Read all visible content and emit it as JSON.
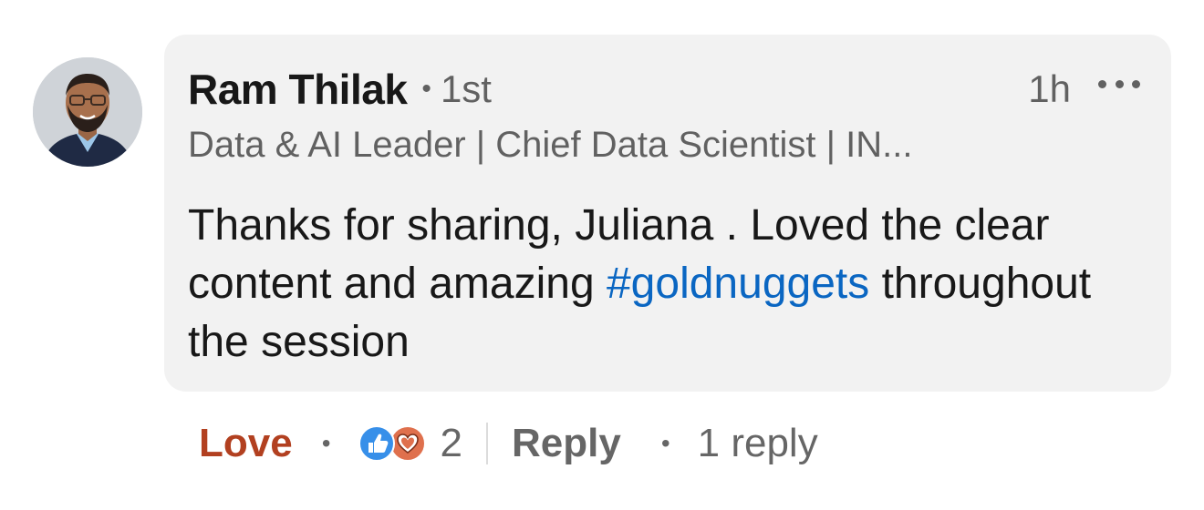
{
  "comment": {
    "author": {
      "name": "Ram Thilak",
      "separator": "•",
      "connection_degree": "1st",
      "headline": "Data & AI Leader | Chief Data Scientist | IN...",
      "avatar_icon": "profile-photo"
    },
    "timestamp": "1h",
    "more_icon": "more-horizontal-icon",
    "text": {
      "before_hashtag": "Thanks for sharing, Juliana . Loved the clear content and amazing ",
      "hashtag": "#goldnuggets",
      "after_hashtag": " throughout the session"
    }
  },
  "actions": {
    "reaction_label": "Love",
    "dot": "•",
    "reaction_icons": [
      "like-icon",
      "love-icon"
    ],
    "reaction_count": "2",
    "reply_label": "Reply",
    "replies_label": "1 reply"
  },
  "colors": {
    "love": "#b24020",
    "hashtag": "#0a66c2",
    "like_icon": "#378fe9",
    "love_icon": "#df704d",
    "bubble": "#f2f2f2"
  }
}
